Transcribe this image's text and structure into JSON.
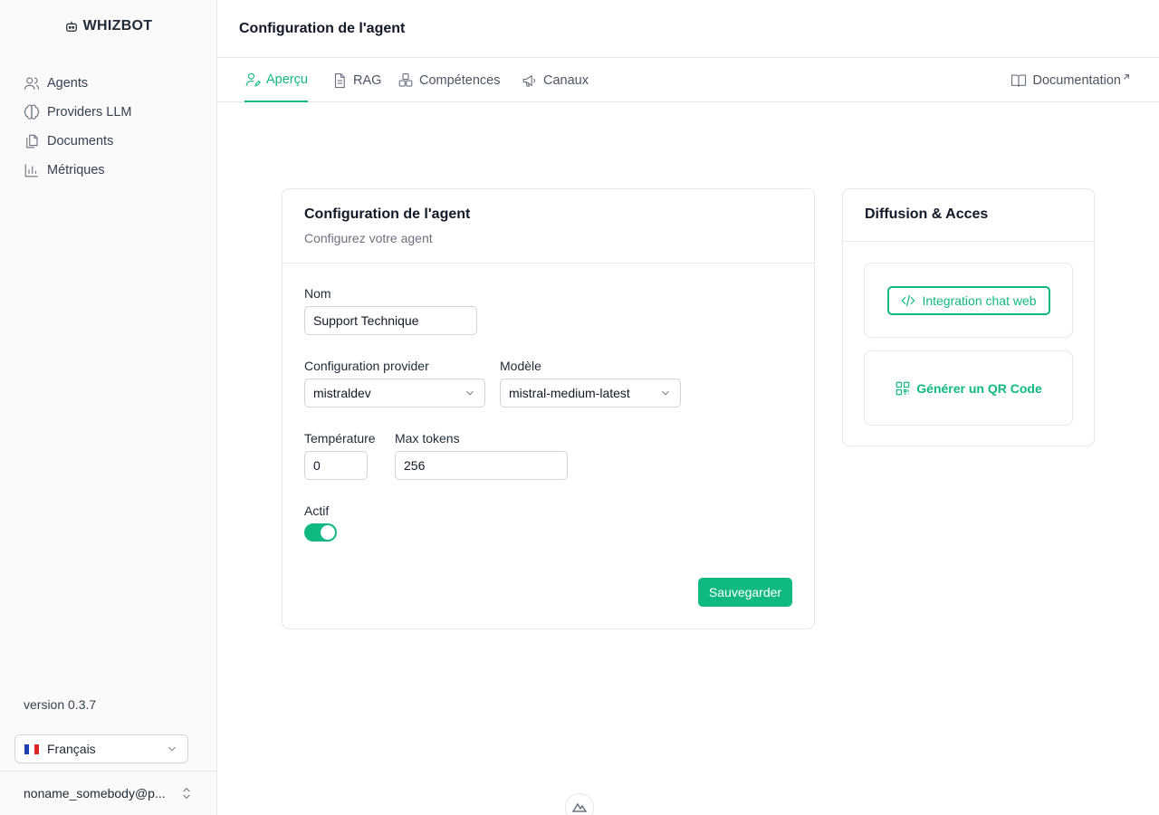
{
  "brand": {
    "name": "WHIZBOT",
    "icon": "robot-icon"
  },
  "sidebar": {
    "items": [
      {
        "label": "Agents",
        "icon": "users-icon"
      },
      {
        "label": "Providers LLM",
        "icon": "brain-icon"
      },
      {
        "label": "Documents",
        "icon": "files-icon"
      },
      {
        "label": "Métriques",
        "icon": "bar-chart-icon"
      }
    ],
    "version": "version 0.3.7",
    "language": {
      "flag": "fr-flag-icon",
      "label": "Français"
    },
    "user": {
      "email": "noname_somebody@p..."
    }
  },
  "header": {
    "title": "Configuration de l'agent"
  },
  "tabs": [
    {
      "label": "Aperçu",
      "icon": "user-edit-icon",
      "active": true
    },
    {
      "label": "RAG",
      "icon": "file-text-icon",
      "active": false
    },
    {
      "label": "Compétences",
      "icon": "boxes-icon",
      "active": false
    },
    {
      "label": "Canaux",
      "icon": "megaphone-icon",
      "active": false
    }
  ],
  "doc_link": {
    "label": "Documentation",
    "icon": "book-icon"
  },
  "config_card": {
    "title": "Configuration de l'agent",
    "subtitle": "Configurez votre agent",
    "name_label": "Nom",
    "name_value": "Support Technique",
    "provider_label": "Configuration provider",
    "provider_value": "mistraldev",
    "model_label": "Modèle",
    "model_value": "mistral-medium-latest",
    "temperature_label": "Température",
    "temperature_value": "0",
    "max_tokens_label": "Max tokens",
    "max_tokens_value": "256",
    "active_label": "Actif",
    "active_value": true,
    "save_label": "Sauvegarder"
  },
  "diffusion_card": {
    "title": "Diffusion & Acces",
    "integration_label": "Integration chat web",
    "qr_label": "Générer un QR Code"
  },
  "colors": {
    "accent": "#10b981",
    "border": "#e5e7eb",
    "text": "#1f2937"
  }
}
